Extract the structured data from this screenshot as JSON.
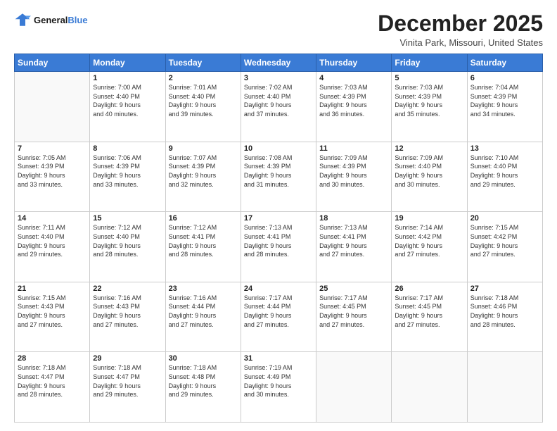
{
  "header": {
    "logo_line1": "General",
    "logo_line2": "Blue",
    "month_title": "December 2025",
    "location": "Vinita Park, Missouri, United States"
  },
  "days_of_week": [
    "Sunday",
    "Monday",
    "Tuesday",
    "Wednesday",
    "Thursday",
    "Friday",
    "Saturday"
  ],
  "weeks": [
    [
      {
        "num": "",
        "info": ""
      },
      {
        "num": "1",
        "info": "Sunrise: 7:00 AM\nSunset: 4:40 PM\nDaylight: 9 hours\nand 40 minutes."
      },
      {
        "num": "2",
        "info": "Sunrise: 7:01 AM\nSunset: 4:40 PM\nDaylight: 9 hours\nand 39 minutes."
      },
      {
        "num": "3",
        "info": "Sunrise: 7:02 AM\nSunset: 4:40 PM\nDaylight: 9 hours\nand 37 minutes."
      },
      {
        "num": "4",
        "info": "Sunrise: 7:03 AM\nSunset: 4:39 PM\nDaylight: 9 hours\nand 36 minutes."
      },
      {
        "num": "5",
        "info": "Sunrise: 7:03 AM\nSunset: 4:39 PM\nDaylight: 9 hours\nand 35 minutes."
      },
      {
        "num": "6",
        "info": "Sunrise: 7:04 AM\nSunset: 4:39 PM\nDaylight: 9 hours\nand 34 minutes."
      }
    ],
    [
      {
        "num": "7",
        "info": "Sunrise: 7:05 AM\nSunset: 4:39 PM\nDaylight: 9 hours\nand 33 minutes."
      },
      {
        "num": "8",
        "info": "Sunrise: 7:06 AM\nSunset: 4:39 PM\nDaylight: 9 hours\nand 33 minutes."
      },
      {
        "num": "9",
        "info": "Sunrise: 7:07 AM\nSunset: 4:39 PM\nDaylight: 9 hours\nand 32 minutes."
      },
      {
        "num": "10",
        "info": "Sunrise: 7:08 AM\nSunset: 4:39 PM\nDaylight: 9 hours\nand 31 minutes."
      },
      {
        "num": "11",
        "info": "Sunrise: 7:09 AM\nSunset: 4:39 PM\nDaylight: 9 hours\nand 30 minutes."
      },
      {
        "num": "12",
        "info": "Sunrise: 7:09 AM\nSunset: 4:40 PM\nDaylight: 9 hours\nand 30 minutes."
      },
      {
        "num": "13",
        "info": "Sunrise: 7:10 AM\nSunset: 4:40 PM\nDaylight: 9 hours\nand 29 minutes."
      }
    ],
    [
      {
        "num": "14",
        "info": "Sunrise: 7:11 AM\nSunset: 4:40 PM\nDaylight: 9 hours\nand 29 minutes."
      },
      {
        "num": "15",
        "info": "Sunrise: 7:12 AM\nSunset: 4:40 PM\nDaylight: 9 hours\nand 28 minutes."
      },
      {
        "num": "16",
        "info": "Sunrise: 7:12 AM\nSunset: 4:41 PM\nDaylight: 9 hours\nand 28 minutes."
      },
      {
        "num": "17",
        "info": "Sunrise: 7:13 AM\nSunset: 4:41 PM\nDaylight: 9 hours\nand 28 minutes."
      },
      {
        "num": "18",
        "info": "Sunrise: 7:13 AM\nSunset: 4:41 PM\nDaylight: 9 hours\nand 27 minutes."
      },
      {
        "num": "19",
        "info": "Sunrise: 7:14 AM\nSunset: 4:42 PM\nDaylight: 9 hours\nand 27 minutes."
      },
      {
        "num": "20",
        "info": "Sunrise: 7:15 AM\nSunset: 4:42 PM\nDaylight: 9 hours\nand 27 minutes."
      }
    ],
    [
      {
        "num": "21",
        "info": "Sunrise: 7:15 AM\nSunset: 4:43 PM\nDaylight: 9 hours\nand 27 minutes."
      },
      {
        "num": "22",
        "info": "Sunrise: 7:16 AM\nSunset: 4:43 PM\nDaylight: 9 hours\nand 27 minutes."
      },
      {
        "num": "23",
        "info": "Sunrise: 7:16 AM\nSunset: 4:44 PM\nDaylight: 9 hours\nand 27 minutes."
      },
      {
        "num": "24",
        "info": "Sunrise: 7:17 AM\nSunset: 4:44 PM\nDaylight: 9 hours\nand 27 minutes."
      },
      {
        "num": "25",
        "info": "Sunrise: 7:17 AM\nSunset: 4:45 PM\nDaylight: 9 hours\nand 27 minutes."
      },
      {
        "num": "26",
        "info": "Sunrise: 7:17 AM\nSunset: 4:45 PM\nDaylight: 9 hours\nand 27 minutes."
      },
      {
        "num": "27",
        "info": "Sunrise: 7:18 AM\nSunset: 4:46 PM\nDaylight: 9 hours\nand 28 minutes."
      }
    ],
    [
      {
        "num": "28",
        "info": "Sunrise: 7:18 AM\nSunset: 4:47 PM\nDaylight: 9 hours\nand 28 minutes."
      },
      {
        "num": "29",
        "info": "Sunrise: 7:18 AM\nSunset: 4:47 PM\nDaylight: 9 hours\nand 29 minutes."
      },
      {
        "num": "30",
        "info": "Sunrise: 7:18 AM\nSunset: 4:48 PM\nDaylight: 9 hours\nand 29 minutes."
      },
      {
        "num": "31",
        "info": "Sunrise: 7:19 AM\nSunset: 4:49 PM\nDaylight: 9 hours\nand 30 minutes."
      },
      {
        "num": "",
        "info": ""
      },
      {
        "num": "",
        "info": ""
      },
      {
        "num": "",
        "info": ""
      }
    ]
  ]
}
